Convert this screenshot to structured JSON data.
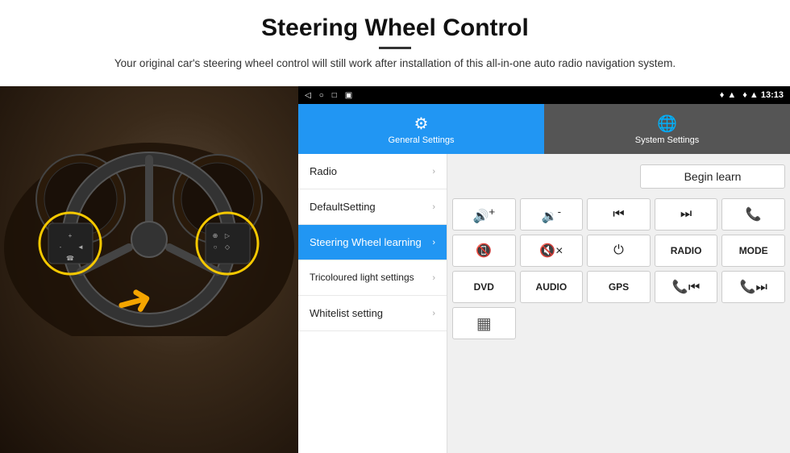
{
  "header": {
    "title": "Steering Wheel Control",
    "divider": true,
    "subtitle": "Your original car's steering wheel control will still work after installation of this all-in-one auto radio navigation system."
  },
  "device": {
    "status_bar": {
      "nav_icons": [
        "◁",
        "○",
        "□",
        "▣"
      ],
      "right_icons": "♦ ▲ 13:13"
    },
    "tabs": [
      {
        "id": "general",
        "icon": "⚙",
        "label": "General Settings",
        "active": true
      },
      {
        "id": "system",
        "icon": "🌐",
        "label": "System Settings",
        "active": false
      }
    ],
    "menu": [
      {
        "id": "radio",
        "label": "Radio",
        "active": false
      },
      {
        "id": "defaultsetting",
        "label": "DefaultSetting",
        "active": false
      },
      {
        "id": "steering",
        "label": "Steering Wheel learning",
        "active": true
      },
      {
        "id": "tricoloured",
        "label": "Tricoloured light settings",
        "active": false
      },
      {
        "id": "whitelist",
        "label": "Whitelist setting",
        "active": false
      }
    ],
    "controls": {
      "begin_learn": "Begin learn",
      "row1": [
        {
          "id": "vol-up",
          "text": "🔊+",
          "label": "volume up"
        },
        {
          "id": "vol-down",
          "text": "🔉-",
          "label": "volume down"
        },
        {
          "id": "prev",
          "text": "⏮",
          "label": "previous"
        },
        {
          "id": "next",
          "text": "⏭",
          "label": "next"
        },
        {
          "id": "phone",
          "text": "📞",
          "label": "phone"
        }
      ],
      "row2": [
        {
          "id": "hang-up",
          "text": "📵",
          "label": "hang up"
        },
        {
          "id": "mute",
          "text": "🔇×",
          "label": "mute"
        },
        {
          "id": "power",
          "text": "⏻",
          "label": "power"
        },
        {
          "id": "radio-btn",
          "text": "RADIO",
          "label": "radio button"
        },
        {
          "id": "mode",
          "text": "MODE",
          "label": "mode"
        }
      ],
      "row3": [
        {
          "id": "dvd",
          "text": "DVD",
          "label": "dvd"
        },
        {
          "id": "audio",
          "text": "AUDIO",
          "label": "audio"
        },
        {
          "id": "gps",
          "text": "GPS",
          "label": "gps"
        },
        {
          "id": "tel-prev",
          "text": "📞⏮",
          "label": "tel prev"
        },
        {
          "id": "tel-next",
          "text": "📞⏭",
          "label": "tel next"
        }
      ],
      "row4_single": {
        "id": "barcode",
        "text": "▦",
        "label": "barcode"
      }
    }
  }
}
